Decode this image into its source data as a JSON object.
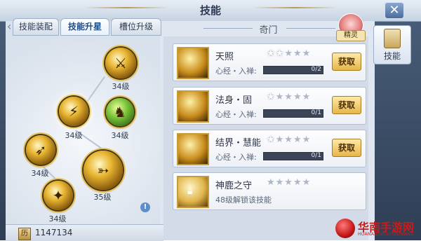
{
  "window": {
    "title": "技能",
    "close_icon": "close-icon"
  },
  "tabs": [
    {
      "label": "技能装配",
      "active": false
    },
    {
      "label": "技能升星",
      "active": true
    },
    {
      "label": "槽位升级",
      "active": false
    }
  ],
  "side_tab": {
    "label": "技能",
    "icon": "scroll-icon"
  },
  "sprite": {
    "label": "精灵"
  },
  "section_title": "奇门",
  "skill_tree": {
    "nodes": [
      {
        "level": "34级",
        "style": "gold",
        "icon": "blades-icon"
      },
      {
        "level": "34级",
        "style": "gold",
        "icon": "slash-icon"
      },
      {
        "level": "34级",
        "style": "green",
        "icon": "warrior-icon"
      },
      {
        "level": "34级",
        "style": "gold",
        "icon": "spear-icon"
      },
      {
        "level": "35级",
        "style": "gold",
        "icon": "arrow-icon"
      },
      {
        "level": "34级",
        "style": "gold",
        "icon": "kick-icon"
      }
    ]
  },
  "skills": [
    {
      "name": "天照",
      "stars_on": 2,
      "stars_total": 5,
      "sub": "心经・入禅:",
      "progress": "0/2",
      "progress_fraction": 0,
      "button": "获取",
      "locked": false
    },
    {
      "name": "法身・固",
      "stars_on": 1,
      "stars_total": 5,
      "sub": "心经・入禅:",
      "progress": "0/1",
      "progress_fraction": 0,
      "button": "获取",
      "locked": false
    },
    {
      "name": "结界・慧能",
      "stars_on": 1,
      "stars_total": 5,
      "sub": "心经・入禅:",
      "progress": "0/1",
      "progress_fraction": 0,
      "button": "获取",
      "locked": false
    },
    {
      "name": "神鹿之守",
      "stars_on": 0,
      "stars_total": 5,
      "sub": "48级解锁该技能",
      "locked": true
    }
  ],
  "footer": {
    "currency_icon": "历",
    "amount": "1147134"
  },
  "watermark": {
    "text": "华南手游网",
    "sub": "HUANANSHOUYOUWANG"
  }
}
